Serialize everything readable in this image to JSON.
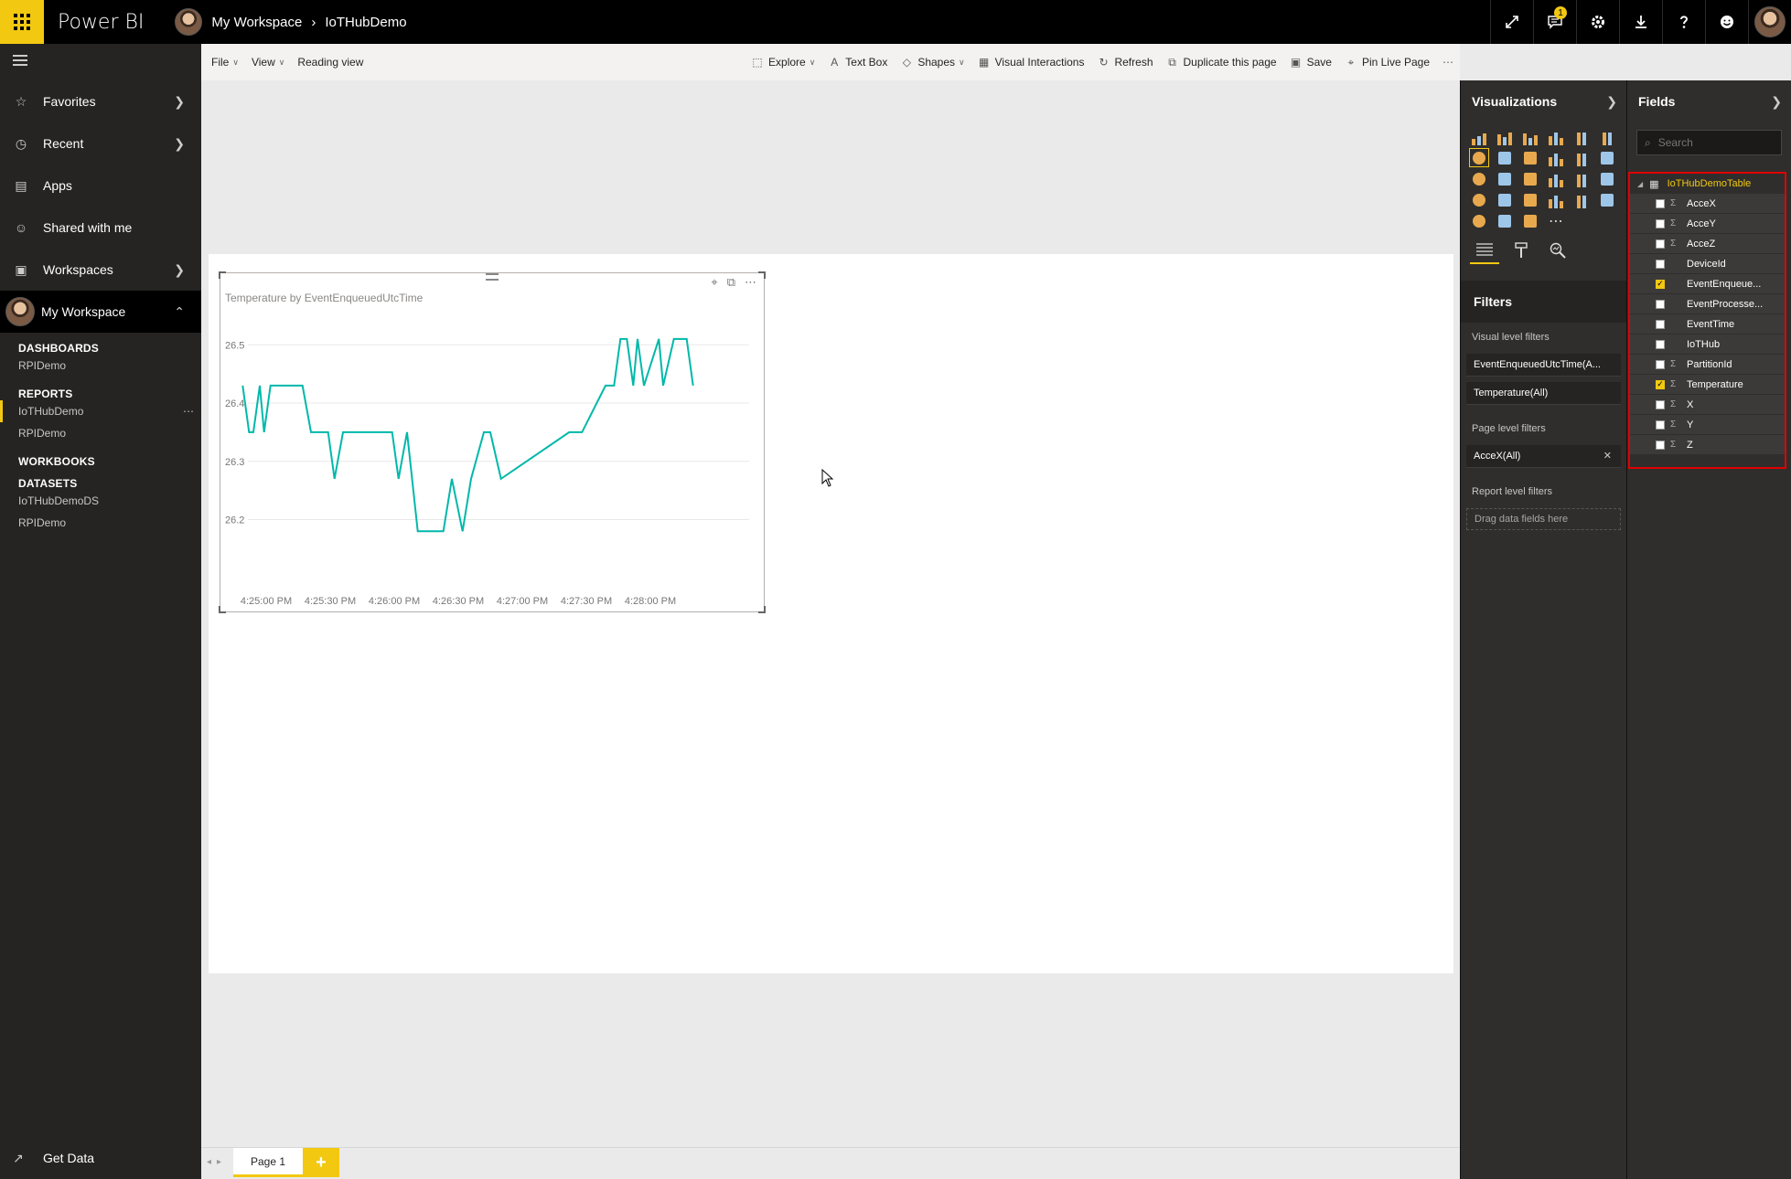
{
  "app": {
    "brand": "Power BI",
    "breadcrumb": [
      "My Workspace",
      "IoTHubDemo"
    ],
    "notification_count": "1"
  },
  "nav": {
    "items": [
      {
        "label": "Favorites",
        "icon": "star-icon"
      },
      {
        "label": "Recent",
        "icon": "clock-icon"
      },
      {
        "label": "Apps",
        "icon": "apps-icon"
      },
      {
        "label": "Shared with me",
        "icon": "shared-icon"
      },
      {
        "label": "Workspaces",
        "icon": "workspaces-icon"
      },
      {
        "label": "My Workspace",
        "icon": "avatar"
      }
    ],
    "sections": {
      "dashboards": {
        "title": "DASHBOARDS",
        "items": [
          "RPIDemo"
        ]
      },
      "reports": {
        "title": "REPORTS",
        "items": [
          "IoTHubDemo",
          "RPIDemo"
        ]
      },
      "workbooks": {
        "title": "WORKBOOKS",
        "items": []
      },
      "datasets": {
        "title": "DATASETS",
        "items": [
          "IoTHubDemoDS",
          "RPIDemo"
        ]
      }
    },
    "get_data": "Get Data"
  },
  "toolbar": {
    "left": [
      "File",
      "View",
      "Reading view"
    ],
    "right": [
      "Explore",
      "Text Box",
      "Shapes",
      "Visual Interactions",
      "Refresh",
      "Duplicate this page",
      "Save",
      "Pin Live Page"
    ]
  },
  "pages": {
    "tabs": [
      "Page 1"
    ],
    "add": "+"
  },
  "visualizations": {
    "title": "Visualizations",
    "filters_title": "Filters",
    "visual_level_label": "Visual level filters",
    "visual_filters": [
      "EventEnqueuedUtcTime(A...",
      "Temperature(All)"
    ],
    "page_level_label": "Page level filters",
    "page_filters": [
      "AcceX(All)"
    ],
    "report_level_label": "Report level filters",
    "drop_hint": "Drag data fields here"
  },
  "fields": {
    "title": "Fields",
    "search_placeholder": "Search",
    "table": "IoTHubDemoTable",
    "items": [
      {
        "name": "AcceX",
        "sigma": true,
        "checked": false
      },
      {
        "name": "AcceY",
        "sigma": true,
        "checked": false
      },
      {
        "name": "AcceZ",
        "sigma": true,
        "checked": false
      },
      {
        "name": "DeviceId",
        "sigma": false,
        "checked": false
      },
      {
        "name": "EventEnqueue...",
        "sigma": false,
        "checked": true
      },
      {
        "name": "EventProcesse...",
        "sigma": false,
        "checked": false
      },
      {
        "name": "EventTime",
        "sigma": false,
        "checked": false
      },
      {
        "name": "IoTHub",
        "sigma": false,
        "checked": false
      },
      {
        "name": "PartitionId",
        "sigma": true,
        "checked": false
      },
      {
        "name": "Temperature",
        "sigma": true,
        "checked": true
      },
      {
        "name": "X",
        "sigma": true,
        "checked": false
      },
      {
        "name": "Y",
        "sigma": true,
        "checked": false
      },
      {
        "name": "Z",
        "sigma": true,
        "checked": false
      }
    ]
  },
  "chart_data": {
    "type": "line",
    "title": "Temperature by EventEnqueuedUtcTime",
    "xlabel": "",
    "ylabel": "",
    "x_ticks": [
      "4:25:00 PM",
      "4:25:30 PM",
      "4:26:00 PM",
      "4:26:30 PM",
      "4:27:00 PM",
      "4:27:30 PM",
      "4:28:00 PM"
    ],
    "xlim_seconds": [
      0,
      180
    ],
    "x_ticks_seconds": [
      0,
      30,
      60,
      90,
      120,
      150,
      180
    ],
    "y_ticks": [
      26.2,
      26.3,
      26.4,
      26.5
    ],
    "ylim": [
      26.16,
      26.56
    ],
    "grid": true,
    "color": "#01b8aa",
    "series": [
      {
        "x": [
          -11,
          -8,
          -6,
          -3,
          -1,
          2,
          17,
          21,
          29,
          32,
          36,
          59,
          62,
          66,
          71,
          83,
          87,
          92,
          96,
          102,
          105,
          110,
          142,
          148,
          159,
          163,
          166,
          169,
          172,
          174,
          177,
          184,
          186,
          191,
          197,
          200
        ],
        "y": [
          26.43,
          26.35,
          26.35,
          26.43,
          26.35,
          26.43,
          26.43,
          26.35,
          26.35,
          26.27,
          26.35,
          26.35,
          26.27,
          26.35,
          26.18,
          26.18,
          26.27,
          26.18,
          26.27,
          26.35,
          26.35,
          26.27,
          26.35,
          26.35,
          26.43,
          26.43,
          26.51,
          26.51,
          26.43,
          26.51,
          26.43,
          26.51,
          26.43,
          26.51,
          26.51,
          26.43
        ]
      }
    ]
  }
}
